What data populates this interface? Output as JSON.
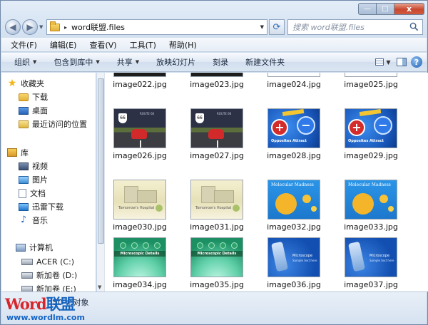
{
  "window": {
    "caption_buttons": {
      "minimize": "—",
      "maximize": "□",
      "close": "x"
    }
  },
  "address": {
    "path_arrow": "▸",
    "path": "word联盟.files",
    "search_placeholder": "搜索 word联盟.files"
  },
  "menu": [
    "文件(F)",
    "编辑(E)",
    "查看(V)",
    "工具(T)",
    "帮助(H)"
  ],
  "commands": [
    {
      "label": "组织",
      "dropdown": true
    },
    {
      "label": "包含到库中",
      "dropdown": true
    },
    {
      "label": "共享",
      "dropdown": true
    },
    {
      "label": "放映幻灯片",
      "dropdown": false
    },
    {
      "label": "刻录",
      "dropdown": false
    },
    {
      "label": "新建文件夹",
      "dropdown": false
    }
  ],
  "nav": {
    "favorites": "收藏夹",
    "downloads": "下载",
    "desktop": "桌面",
    "recent": "最近访问的位置",
    "libraries": "库",
    "videos": "视频",
    "pictures": "图片",
    "documents": "文档",
    "xunlei": "迅雷下载",
    "music": "音乐",
    "computer": "计算机",
    "drive_c": "ACER (C:)",
    "drive_d": "新加卷 (D:)",
    "drive_e": "新加卷 (E:)"
  },
  "files": [
    {
      "name": "image022.jpg",
      "thumb": "t-top"
    },
    {
      "name": "image023.jpg",
      "thumb": "t-top"
    },
    {
      "name": "image024.jpg",
      "thumb": "t-top2"
    },
    {
      "name": "image025.jpg",
      "thumb": "t-top2"
    },
    {
      "name": "image026.jpg",
      "thumb": "t-road"
    },
    {
      "name": "image027.jpg",
      "thumb": "t-road"
    },
    {
      "name": "image028.jpg",
      "thumb": "t-blue"
    },
    {
      "name": "image029.jpg",
      "thumb": "t-blue"
    },
    {
      "name": "image030.jpg",
      "thumb": "t-city"
    },
    {
      "name": "image031.jpg",
      "thumb": "t-city"
    },
    {
      "name": "image032.jpg",
      "thumb": "t-mol"
    },
    {
      "name": "image033.jpg",
      "thumb": "t-mol"
    },
    {
      "name": "image034.jpg",
      "thumb": "t-micro"
    },
    {
      "name": "image035.jpg",
      "thumb": "t-micro"
    },
    {
      "name": "image036.jpg",
      "thumb": "t-scope"
    },
    {
      "name": "image037.jpg",
      "thumb": "t-scope"
    }
  ],
  "thumb_text": {
    "route_sign": "66",
    "route_title": "ROUTE 66",
    "opposites": "Opposites Attract",
    "molecular": "Molecular Madness",
    "micro": "Microscopic Details",
    "scope": "Microscope",
    "scope_sub": "Sample text here",
    "hospital": "Tomorrow's Hospital"
  },
  "status": {
    "count": "50 个对象"
  },
  "watermark": {
    "logo_a": "Word",
    "logo_b": "联盟",
    "url": "www.wordlm.com"
  },
  "colors": {
    "close_button": "#c8482f",
    "accent_blue": "#1463c0",
    "logo_red": "#d8252c"
  }
}
